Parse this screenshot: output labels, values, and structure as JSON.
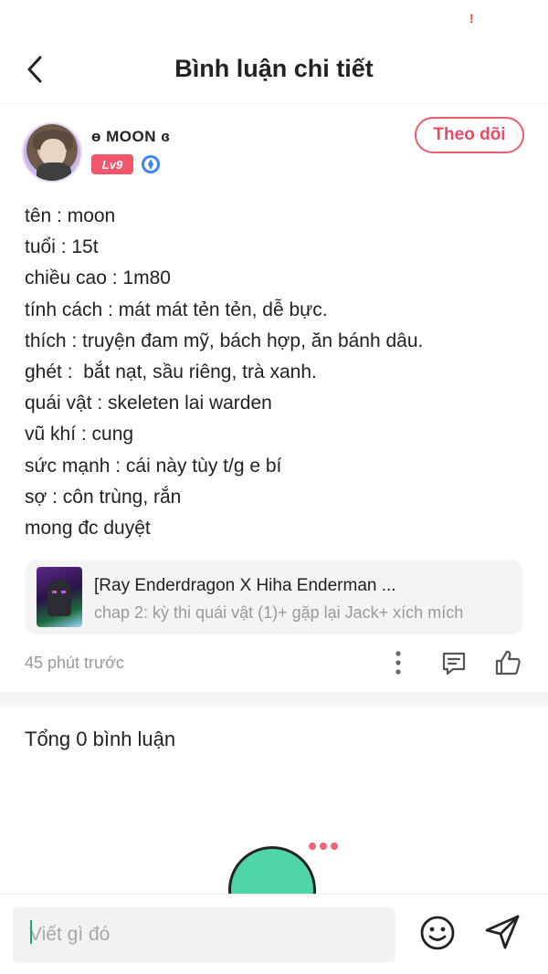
{
  "status_bar": {
    "alert": "!"
  },
  "header": {
    "title": "Bình luận chi tiết",
    "back_icon": "chevron-left-icon"
  },
  "post": {
    "author": {
      "name": "ɵ MOON ɞ",
      "level": "Lv9",
      "verified_icon": "shield-badge-icon",
      "follow_label": "Theo dõi"
    },
    "lines": [
      "tên : moon",
      "tuổi : 15t",
      "chiều cao : 1m80",
      "tính cách : mát mát tẻn tẻn, dễ bực.",
      "thích : truyện đam mỹ, bách hợp, ăn bánh dâu.",
      "ghét :  bắt nạt, sầu riêng, trà xanh.",
      "quái vật : skeleten lai warden",
      "vũ khí : cung",
      "sức mạnh : cái này tùy t/g e bí",
      "sợ : côn trùng, rắn",
      "mong đc duyệt"
    ],
    "story": {
      "title": "[Ray Enderdragon X Hiha Enderman ...",
      "subtitle": "chap 2: kỳ thi quái vật (1)+ gặp lại Jack+ xích mích"
    },
    "timestamp": "45 phút trước"
  },
  "comments": {
    "total_label": "Tổng 0 bình luận"
  },
  "composer": {
    "placeholder": "Viết gì đó"
  },
  "colors": {
    "accent": "#ef5a6c",
    "level_badge": "#f0566e",
    "mascot": "#4fd6a8"
  }
}
